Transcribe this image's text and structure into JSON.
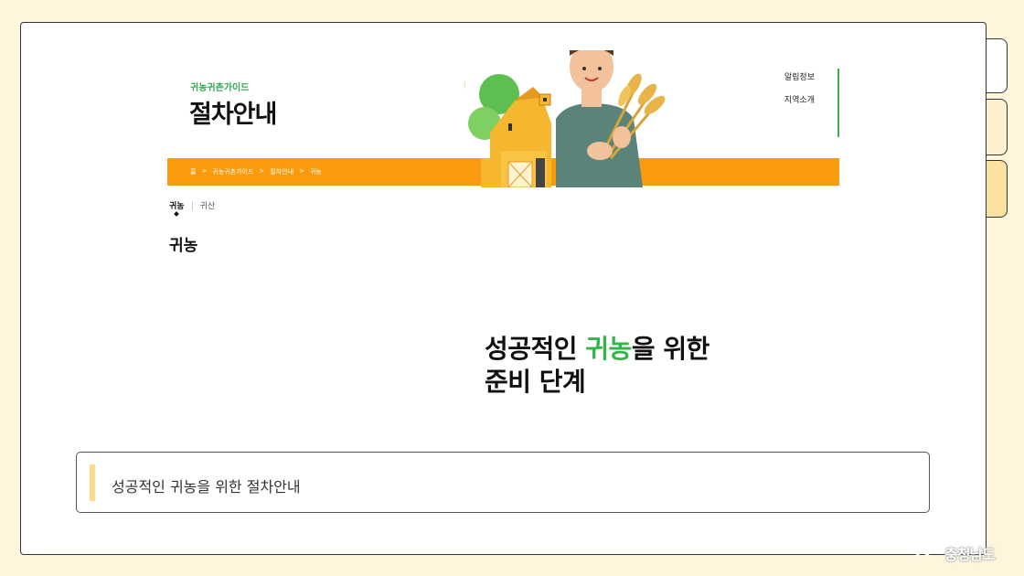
{
  "header": {
    "guide_label": "귀농귀촌가이드",
    "page_title": "절차안내",
    "right_menu": [
      "알림정보",
      "지역소개"
    ],
    "breadcrumb": [
      "홈",
      "귀농귀촌가이드",
      "절차안내",
      "귀농"
    ],
    "breadcrumb_separator": ">"
  },
  "sub_tabs": [
    {
      "label": "귀농",
      "active": true
    },
    {
      "label": "귀산",
      "active": false
    }
  ],
  "section_title": "귀농",
  "headline": {
    "line1_pre": "성공적인 ",
    "line1_highlight": "귀농",
    "line1_post": "을 위한",
    "line2": "준비 단계"
  },
  "caption": "성공적인 귀농을 위한 절차안내",
  "watermark": "충청남도",
  "colors": {
    "accent_green": "#34b44a",
    "orange_bar": "#f99b0c",
    "background": "#fdf5dc",
    "caption_marker": "#fdd98b"
  }
}
